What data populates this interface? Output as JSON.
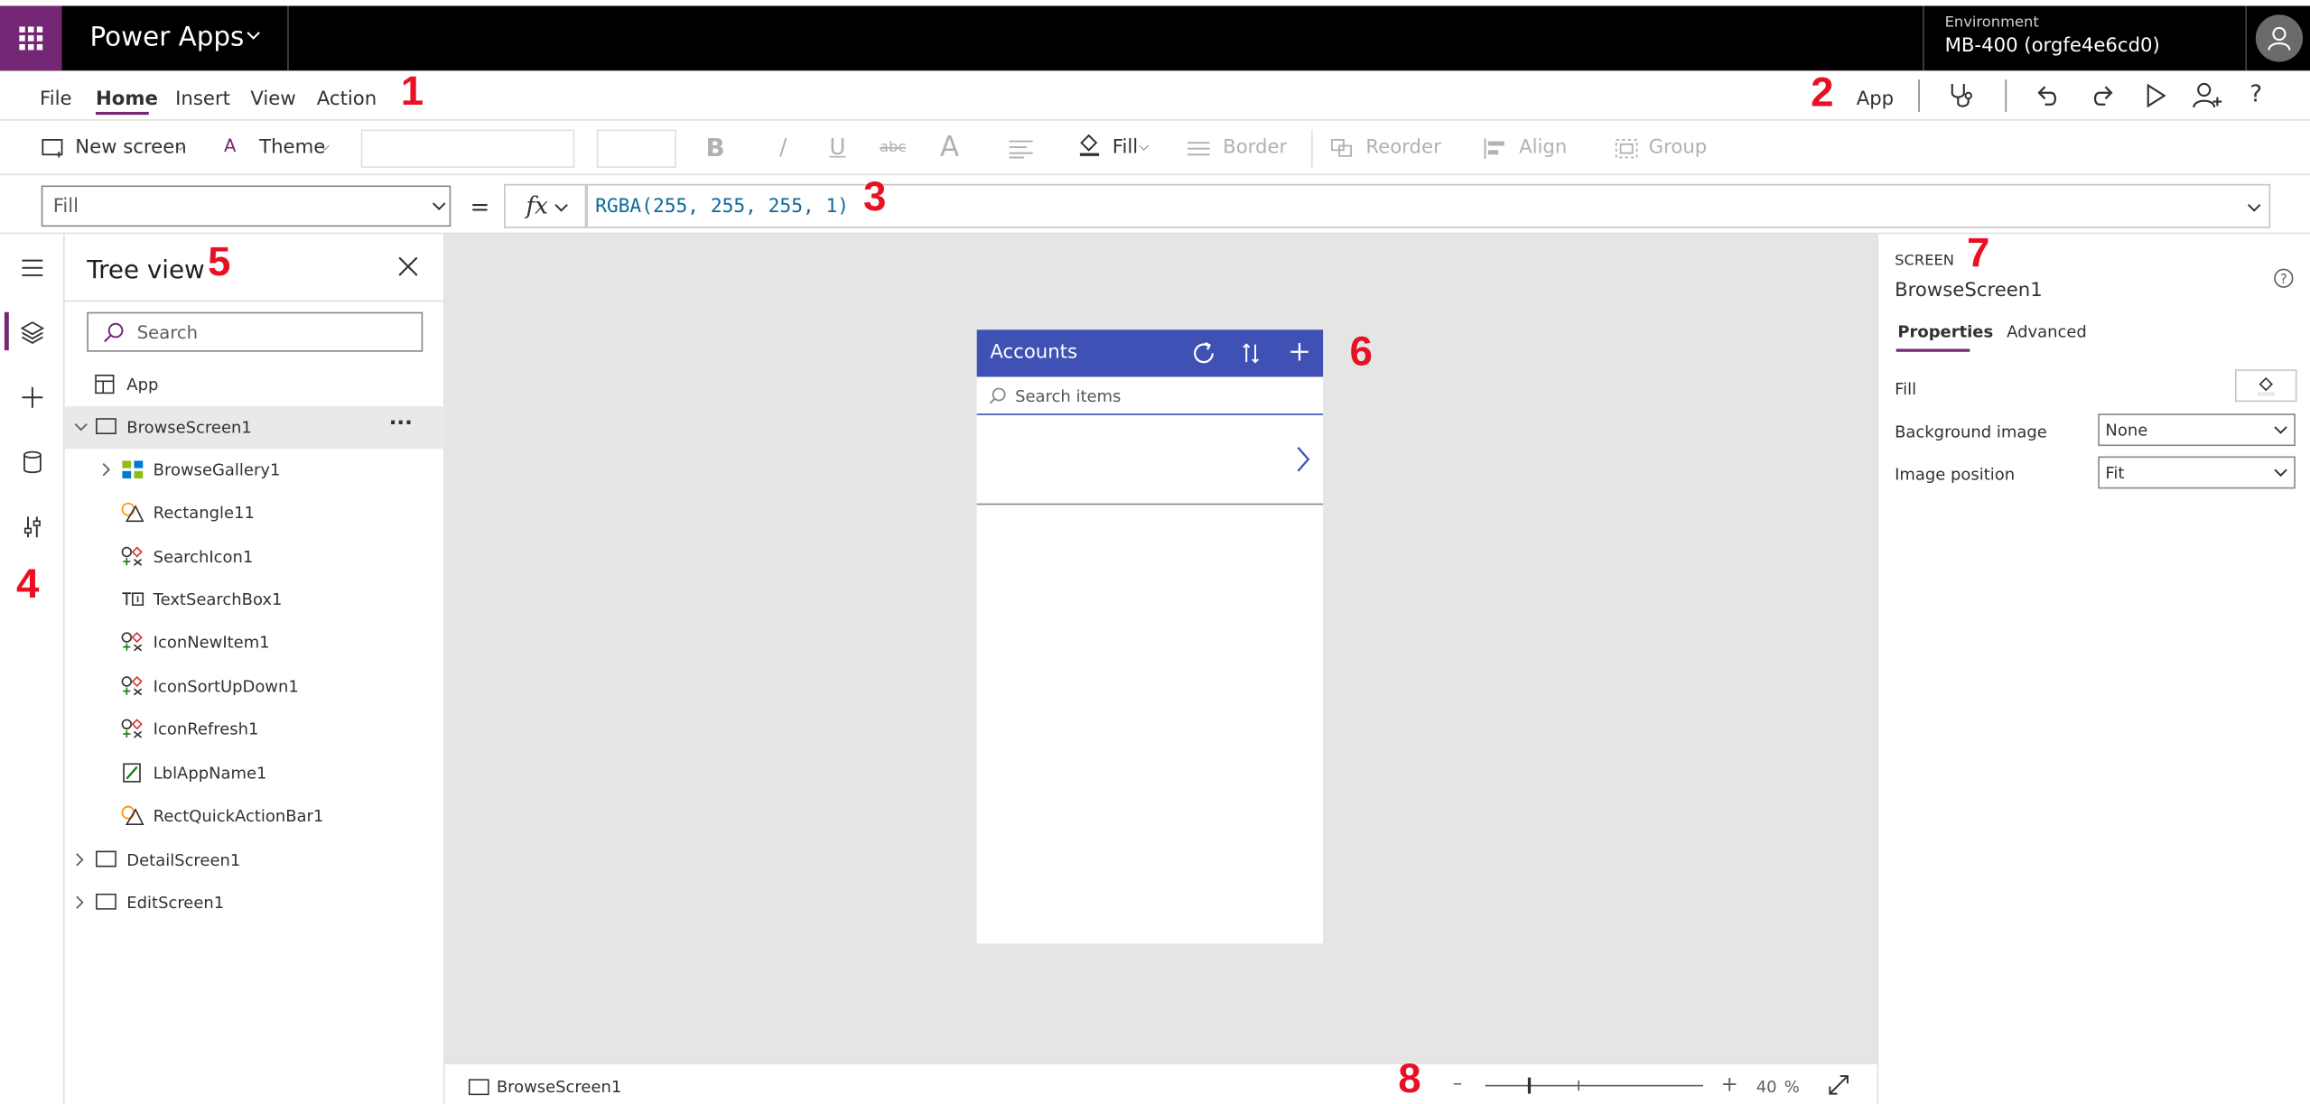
{
  "app": {
    "name": "Power Apps"
  },
  "environment": {
    "label": "Environment",
    "value": "MB-400 (orgfe4e6cd0)"
  },
  "menu": {
    "items": [
      "File",
      "Home",
      "Insert",
      "View",
      "Action"
    ],
    "active": "Home",
    "right_label": "App"
  },
  "ribbon": {
    "new_screen": "New screen",
    "theme": "Theme",
    "fill": "Fill",
    "border": "Border",
    "reorder": "Reorder",
    "align": "Align",
    "group": "Group",
    "bold": "B",
    "italic": "/",
    "underline": "U",
    "strike": "abc",
    "font_color": "A"
  },
  "formula_bar": {
    "property": "Fill",
    "equals": "=",
    "fx": "fx",
    "formula": "RGBA(255, 255, 255, 1)"
  },
  "tree_view": {
    "title": "Tree view",
    "search_placeholder": "Search",
    "app_label": "App",
    "screens": [
      {
        "name": "BrowseScreen1",
        "expanded": true
      },
      {
        "name": "DetailScreen1",
        "expanded": false
      },
      {
        "name": "EditScreen1",
        "expanded": false
      }
    ],
    "children": [
      "BrowseGallery1",
      "Rectangle11",
      "SearchIcon1",
      "TextSearchBox1",
      "IconNewItem1",
      "IconSortUpDown1",
      "IconRefresh1",
      "LblAppName1",
      "RectQuickActionBar1"
    ],
    "more": "···"
  },
  "canvas": {
    "phone_title": "Accounts",
    "search_placeholder": "Search items",
    "header_color": "#3f51b5"
  },
  "status_bar": {
    "screen_name": "BrowseScreen1",
    "zoom_minus": "–",
    "zoom_plus": "+",
    "zoom_value": "40",
    "zoom_unit": "%"
  },
  "properties": {
    "kind": "SCREEN",
    "name": "BrowseScreen1",
    "tabs": [
      "Properties",
      "Advanced"
    ],
    "active_tab": "Properties",
    "fill_label": "Fill",
    "background_image_label": "Background image",
    "background_image_value": "None",
    "image_position_label": "Image position",
    "image_position_value": "Fit"
  },
  "annotations": [
    "1",
    "2",
    "3",
    "4",
    "5",
    "6",
    "7",
    "8"
  ],
  "colors": {
    "accent": "#742774",
    "annotation": "#e81123"
  }
}
